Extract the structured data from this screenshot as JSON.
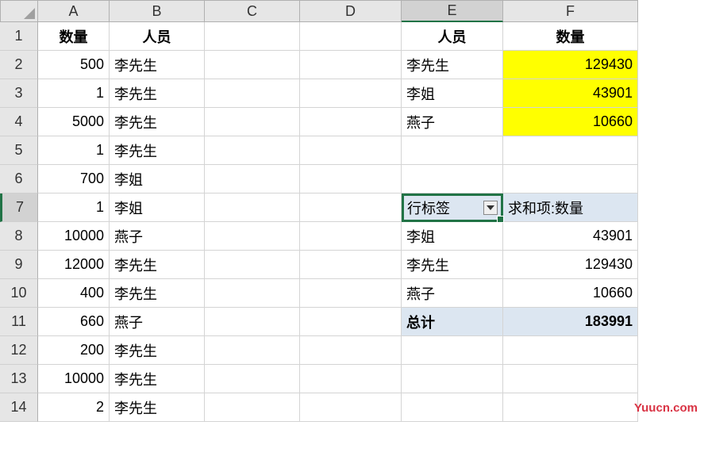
{
  "columns": [
    "A",
    "B",
    "C",
    "D",
    "E",
    "F"
  ],
  "rows": [
    {
      "n": 1,
      "A": "数量",
      "B": "人员",
      "E": "人员",
      "F": "数量",
      "boldA": true,
      "boldB": true,
      "boldE": true,
      "boldF": true,
      "centerAB": true,
      "centerEF": true
    },
    {
      "n": 2,
      "A": "500",
      "B": "李先生",
      "E": "李先生",
      "F": "129430",
      "yellowF": true
    },
    {
      "n": 3,
      "A": "1",
      "B": "李先生",
      "E": "李姐",
      "F": "43901",
      "yellowF": true
    },
    {
      "n": 4,
      "A": "5000",
      "B": "李先生",
      "E": "燕子",
      "F": "10660",
      "yellowF": true
    },
    {
      "n": 5,
      "A": "1",
      "B": "李先生"
    },
    {
      "n": 6,
      "A": "700",
      "B": "李姐"
    },
    {
      "n": 7,
      "A": "1",
      "B": "李姐",
      "E": "行标签",
      "F": "求和项:数量",
      "pivot": true,
      "selected": true
    },
    {
      "n": 8,
      "A": "10000",
      "B": "燕子",
      "E": "李姐",
      "F": "43901"
    },
    {
      "n": 9,
      "A": "12000",
      "B": "李先生",
      "E": "李先生",
      "F": "129430"
    },
    {
      "n": 10,
      "A": "400",
      "B": "李先生",
      "E": "燕子",
      "F": "10660"
    },
    {
      "n": 11,
      "A": "660",
      "B": "燕子",
      "E": "总计",
      "F": "183991",
      "pivot": true,
      "boldE": true,
      "boldF": true
    },
    {
      "n": 12,
      "A": "200",
      "B": "李先生"
    },
    {
      "n": 13,
      "A": "10000",
      "B": "李先生"
    },
    {
      "n": 14,
      "A": "2",
      "B": "李先生"
    }
  ],
  "watermark": "Yuucn.com"
}
